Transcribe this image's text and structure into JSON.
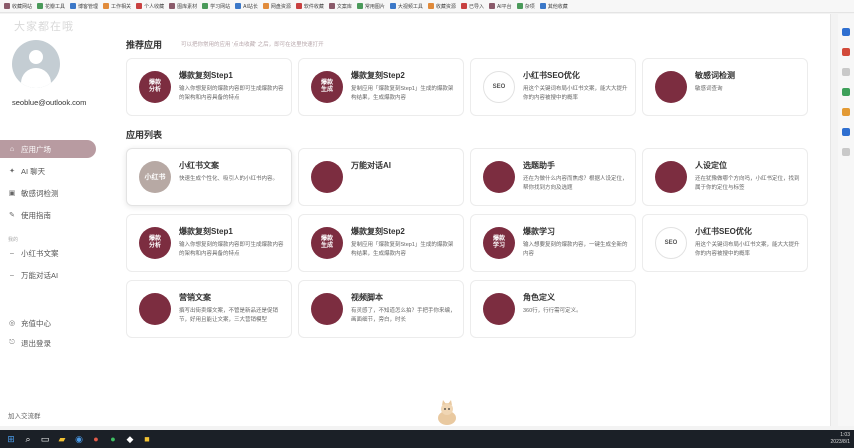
{
  "bookmarks": [
    "收藏网站",
    "花瓣工具",
    "博客管理",
    "工作相关",
    "个人收藏",
    "图库素材",
    "学习网站",
    "AI站长",
    "网盘资源",
    "软件收藏",
    "文案库",
    "常用图片",
    "大视频工具",
    "收藏资源",
    "已导入",
    "AI平台",
    "杂项",
    "其他收藏"
  ],
  "sidebar": {
    "watermark": "大家都在哦",
    "email": "seoblue@outlook.com",
    "nav": [
      {
        "label": "应用广场",
        "icon": "home-icon"
      },
      {
        "label": "AI 聊天",
        "icon": "chat-icon"
      },
      {
        "label": "敏感词检测",
        "icon": "shield-icon"
      },
      {
        "label": "使用指南",
        "icon": "guide-icon"
      }
    ],
    "section_label": "我的",
    "my_apps": [
      "小红书文案",
      "万能对话AI"
    ],
    "account": [
      {
        "label": "充值中心",
        "icon": "wallet-icon"
      },
      {
        "label": "退出登录",
        "icon": "logout-icon"
      }
    ],
    "footer": "加入交流群"
  },
  "recommended": {
    "title": "推荐应用",
    "hint": "可以把你常用的应用 '点击收藏' 之后，即可在这里快速打开",
    "cards": [
      {
        "icon_text": "爆款\n分析",
        "title": "爆款复刻Step1",
        "desc": "输入你想复刻的爆款内容即可生成爆款内容的架构和内容具备的特点"
      },
      {
        "icon_text": "爆款\n生成",
        "title": "爆款复刻Step2",
        "desc": "复制应用「爆款复刻Step1」生成的爆款架构结果，生成爆款内容"
      },
      {
        "icon_text": "SEO",
        "title": "小红书SEO优化",
        "desc": "用这个关键词布局小红书文案，能大大提升你的内容被搜中的概率"
      },
      {
        "icon_text": "",
        "title": "敏感词检测",
        "desc": "敏感词查询"
      }
    ]
  },
  "apps": {
    "title": "应用列表",
    "cards": [
      {
        "icon_text": "小红书",
        "title": "小红书文案",
        "desc": "快速生成个性化、吸引人的小红书内容。"
      },
      {
        "icon_text": "",
        "title": "万能对话AI",
        "desc": ""
      },
      {
        "icon_text": "",
        "title": "选题助手",
        "desc": "还在为做什么内容而焦虑？根据人设定位，帮你找到方向及选题"
      },
      {
        "icon_text": "",
        "title": "人设定位",
        "desc": "还在犹豫做哪个方向吗，小红书定位，找到属于你的定位与标签"
      },
      {
        "icon_text": "爆款\n分析",
        "title": "爆款复刻Step1",
        "desc": "输入你想复刻的爆款内容即可生成爆款内容的架构和内容具备的特点"
      },
      {
        "icon_text": "爆款\n生成",
        "title": "爆款复刻Step2",
        "desc": "复制应用「爆款复刻Step1」生成的爆款架构结果，生成爆款内容"
      },
      {
        "icon_text": "爆款\n学习",
        "title": "爆款学习",
        "desc": "输入想要复刻的爆款内容，一键生成全新的内容"
      },
      {
        "icon_text": "SEO",
        "title": "小红书SEO优化",
        "desc": "用这个关键词布局小红书文案，能大大提升你的内容被搜中的概率"
      },
      {
        "icon_text": "",
        "title": "营销文案",
        "desc": "撰写出街卖爆文案，不管是新品还是促销节，好用且能让文案，三大营销模型"
      },
      {
        "icon_text": "",
        "title": "视频脚本",
        "desc": "有灵感了，不知道怎么拍？手把手你来编，画面细节，旁白，时长"
      },
      {
        "icon_text": "",
        "title": "角色定义",
        "desc": "360行，行行需可定义。"
      }
    ]
  },
  "clock": {
    "time": "1:03",
    "date": "2023/8/1"
  }
}
